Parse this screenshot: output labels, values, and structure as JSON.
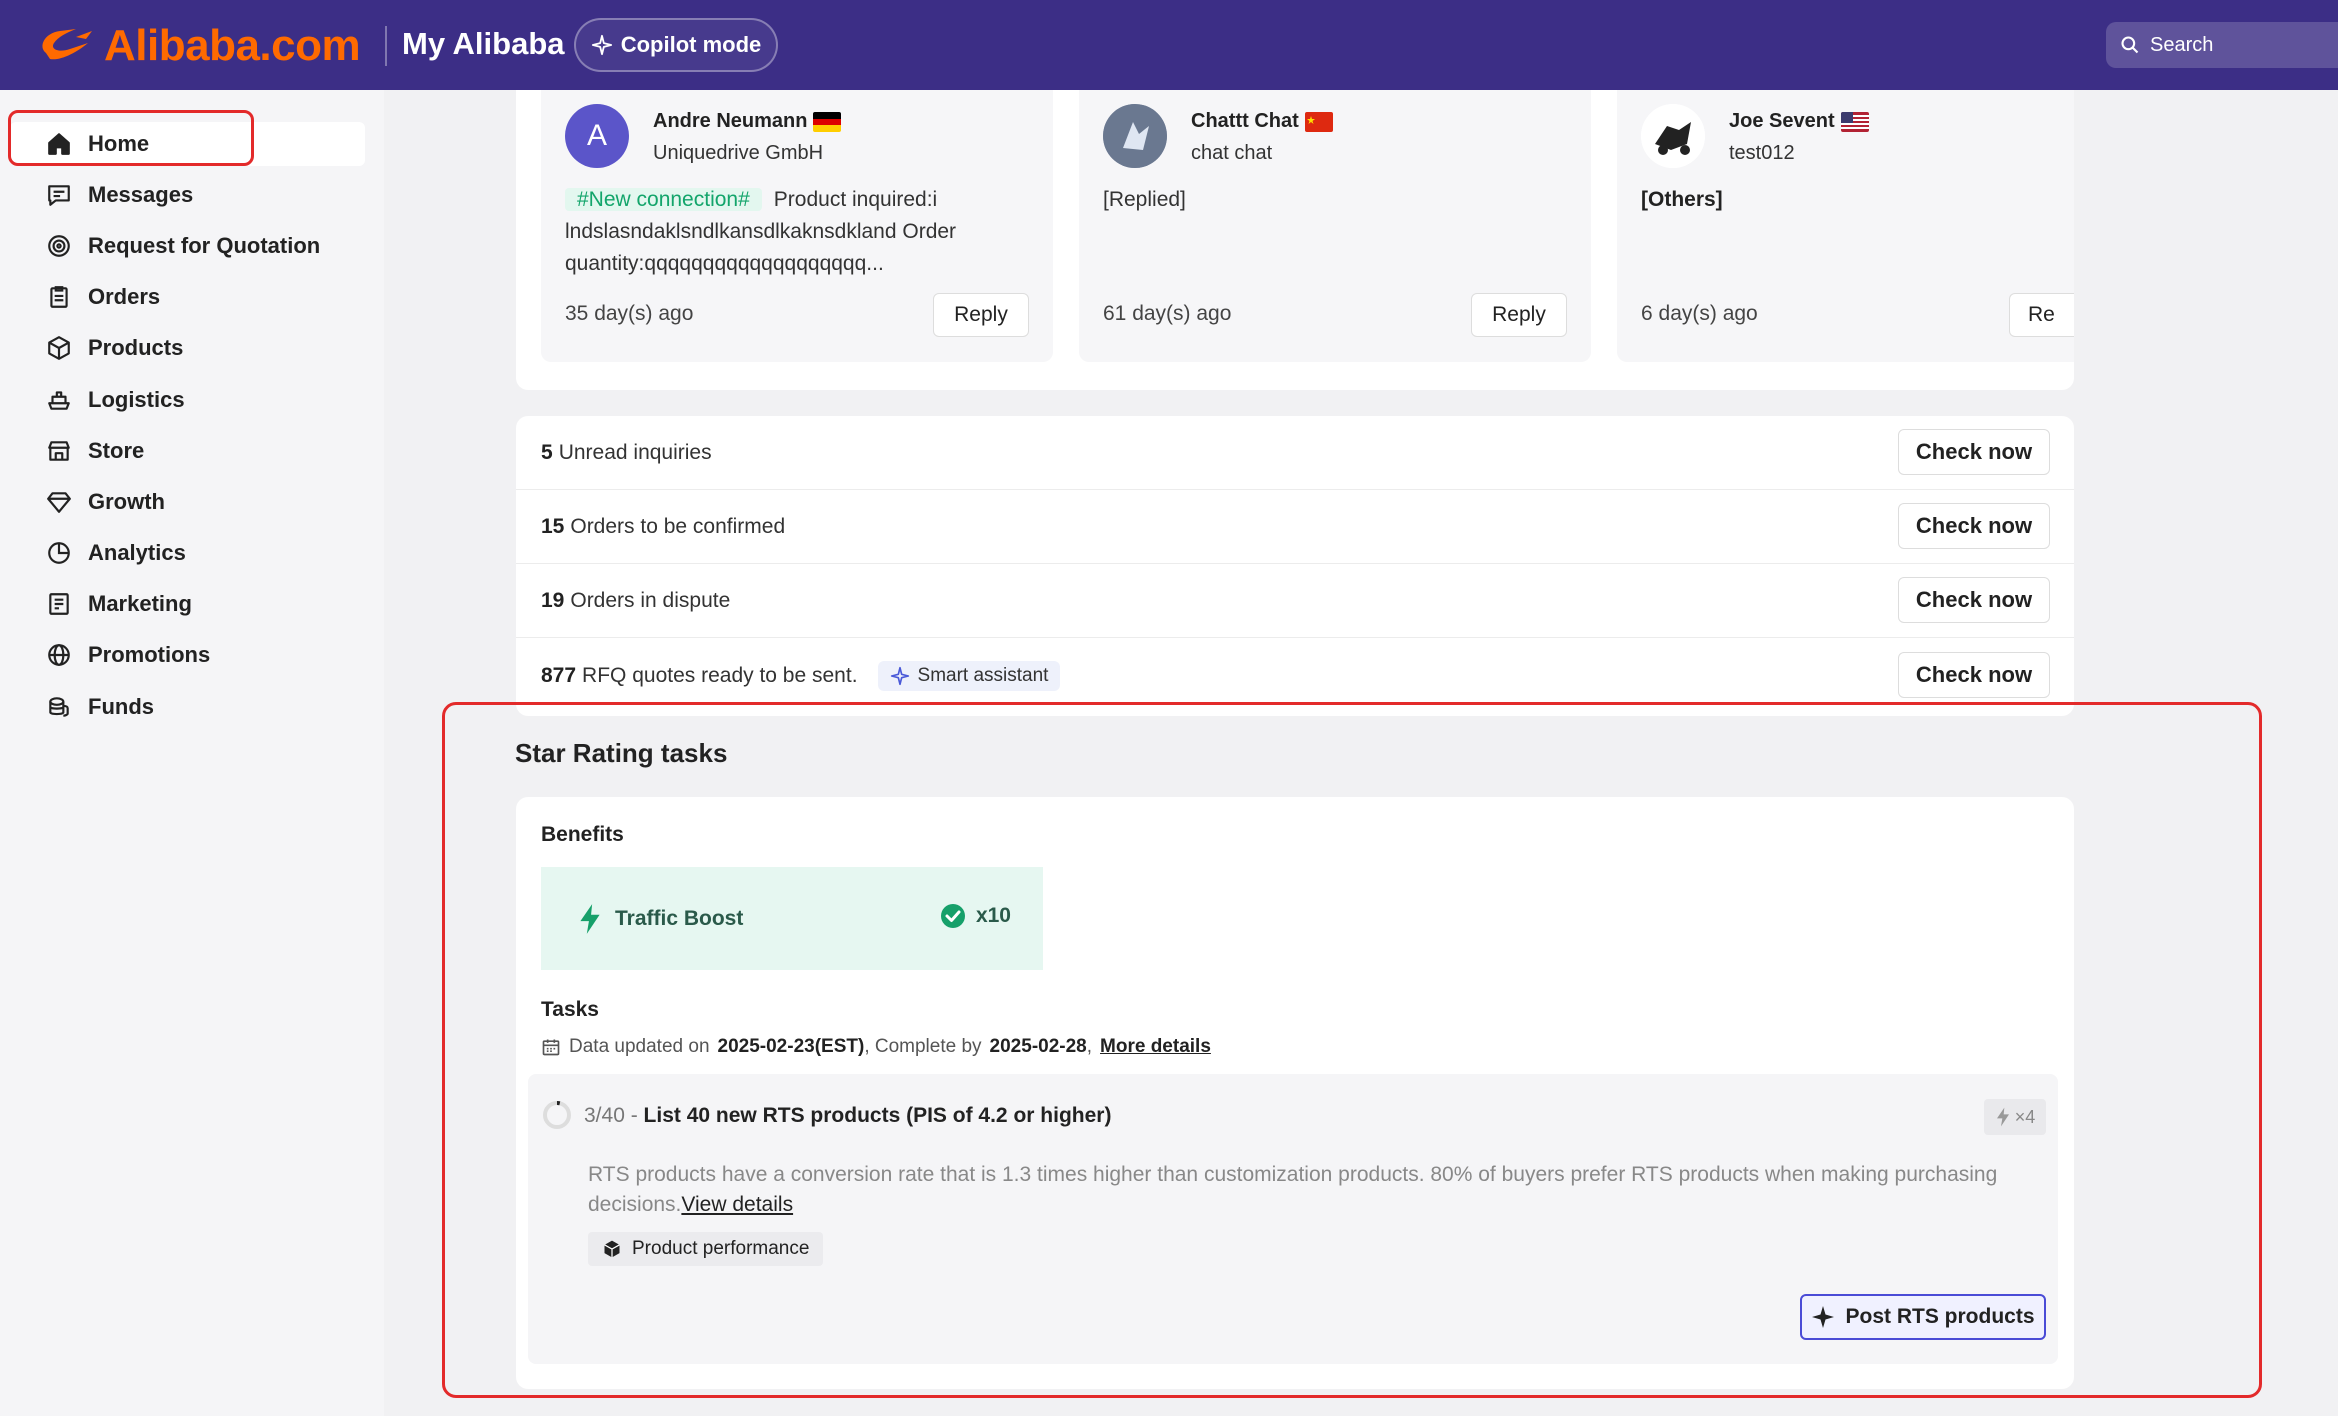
{
  "header": {
    "logo_text": "Alibaba.com",
    "title": "My Alibaba",
    "copilot_label": "Copilot mode",
    "search_placeholder": "Search"
  },
  "sidebar": {
    "items": [
      {
        "label": "Home",
        "icon": "home-icon",
        "active": true
      },
      {
        "label": "Messages",
        "icon": "messages-icon"
      },
      {
        "label": "Request for Quotation",
        "icon": "target-icon"
      },
      {
        "label": "Orders",
        "icon": "clipboard-icon"
      },
      {
        "label": "Products",
        "icon": "cube-icon"
      },
      {
        "label": "Logistics",
        "icon": "ship-icon"
      },
      {
        "label": "Store",
        "icon": "store-icon"
      },
      {
        "label": "Growth",
        "icon": "diamond-icon"
      },
      {
        "label": "Analytics",
        "icon": "pie-chart-icon"
      },
      {
        "label": "Marketing",
        "icon": "ad-icon"
      },
      {
        "label": "Promotions",
        "icon": "globe-icon"
      },
      {
        "label": "Funds",
        "icon": "coins-icon"
      }
    ]
  },
  "messages": [
    {
      "name": "Andre Neumann",
      "company": "Uniquedrive GmbH",
      "avatar_letter": "A",
      "flag": "de",
      "tag": "#New connection#",
      "body": "Product inquired:i lndslasndaklsndlkansdlkaknsdkland Order quantity:qqqqqqqqqqqqqqqqqqq...",
      "time": "35 day(s) ago",
      "reply": "Reply"
    },
    {
      "name": "Chattt Chat",
      "company": "chat chat",
      "flag": "cn",
      "body": "[Replied]",
      "time": "61 day(s) ago",
      "reply": "Reply"
    },
    {
      "name": "Joe Sevent",
      "company": "test012",
      "flag": "us",
      "body": "[Others]",
      "time": "6 day(s) ago",
      "reply": "Re"
    }
  ],
  "inquiries": [
    {
      "count": "5",
      "label": "Unread inquiries",
      "button": "Check now"
    },
    {
      "count": "15",
      "label": "Orders to be confirmed",
      "button": "Check now"
    },
    {
      "count": "19",
      "label": "Orders in dispute",
      "button": "Check now"
    },
    {
      "count": "877",
      "label": "RFQ quotes ready to be sent.",
      "button": "Check now",
      "badge": "Smart assistant"
    }
  ],
  "star_rating": {
    "title": "Star Rating tasks",
    "benefits_label": "Benefits",
    "benefit_name": "Traffic Boost",
    "benefit_multiplier": "x10",
    "tasks_label": "Tasks",
    "meta_prefix": "Data updated on",
    "meta_date": "2025-02-23(EST)",
    "meta_mid": ", Complete by",
    "meta_due": "2025-02-28",
    "meta_link": "More details",
    "task": {
      "progress": "3/40 -",
      "title": "List 40 new RTS products (PIS of 4.2 or higher)",
      "badge": "×4",
      "description": "RTS products have a conversion rate that is 1.3 times higher than customization products. 80% of buyers prefer RTS products when making purchasing decisions.",
      "link": "View details",
      "chip": "Product performance",
      "cta": "Post RTS products"
    }
  },
  "colors": {
    "header_bg": "#3c2e86",
    "brand_orange": "#ff6a00",
    "annotation_red": "#e32a2a",
    "success_green": "#13a56b"
  }
}
